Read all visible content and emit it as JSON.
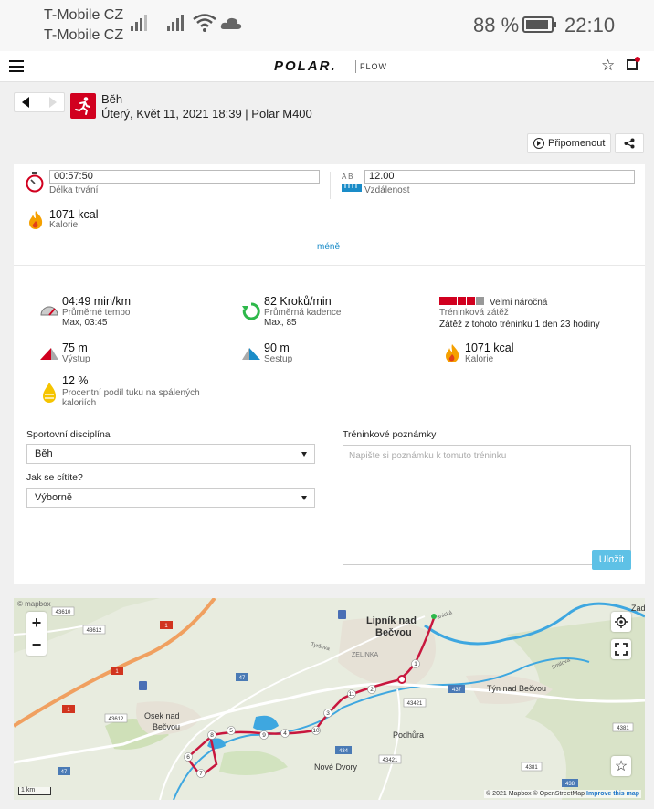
{
  "status": {
    "carrier1": "T-Mobile CZ",
    "carrier2": "T-Mobile CZ",
    "battery": "88 %",
    "time": "22:10"
  },
  "header": {
    "logo": "POLAR.",
    "product": "FLOW"
  },
  "session": {
    "title": "Běh",
    "subtitle": "Úterý, Květ 11, 2021 18:39 | Polar M400",
    "remind_label": "Připomenout"
  },
  "summary": {
    "duration_value": "00:57:50",
    "duration_label": "Délka trvání",
    "distance_value": "12.00",
    "distance_label": "Vzdálenost",
    "calories_value": "1071 kcal",
    "calories_label": "Kalorie",
    "less_link": "méně",
    "ab_label": "A  B"
  },
  "stats": {
    "pace_value": "04:49 min/km",
    "pace_label": "Průměrné tempo",
    "pace_max": "Max, 03:45",
    "cadence_value": "82 Kroků/min",
    "cadence_label": "Průměrná kadence",
    "cadence_max": "Max, 85",
    "load_level": "Velmi náročná",
    "load_label": "Tréninková zátěž",
    "load_note": "Zátěž z tohoto tréninku 1 den 23 hodiny",
    "load_filled": 4,
    "load_total": 5,
    "ascent_value": "75 m",
    "ascent_label": "Výstup",
    "descent_value": "90 m",
    "descent_label": "Sestup",
    "calories_value": "1071 kcal",
    "calories_label": "Kalorie",
    "fat_value": "12 %",
    "fat_label1": "Procentní podíl tuku na spálených",
    "fat_label2": "kaloriích"
  },
  "form": {
    "sport_label": "Sportovní disciplína",
    "sport_value": "Běh",
    "feeling_label": "Jak se cítíte?",
    "feeling_value": "Výborně",
    "notes_label": "Tréninkové poznámky",
    "notes_placeholder": "Napište si poznámku k tomuto tréninku",
    "save_label": "Uložit"
  },
  "map": {
    "zoom_in": "+",
    "zoom_out": "−",
    "scale": "1 km",
    "logo": "© mapbox",
    "attribution_prefix": "© 2021 Mapbox © OpenStreetMap",
    "attribution_link": "Improve this map",
    "labels": {
      "lipnik1": "Lipník nad",
      "lipnik2": "Bečvou",
      "osek1": "Osek nad",
      "osek2": "Bečvou",
      "tyn": "Týn nad Bečvou",
      "podhura": "Podhůra",
      "nove_dvory": "Nové Dvory",
      "zelinka": "ZELINKA",
      "zad": "Zad",
      "tyrsova": "Tyršova",
      "smilova": "Smilova",
      "panicka": "anická"
    },
    "road_numbers": {
      "r43610": "43610",
      "r43612": "43612",
      "r1a": "1",
      "r1b": "1",
      "r47a": "47",
      "r47b": "47",
      "r43612b": "43612",
      "r437": "437",
      "r43421": "43421",
      "r4381": "4381",
      "r434": "434",
      "r43421b": "43421",
      "r4381b": "4381",
      "r438": "438"
    },
    "km_markers": [
      "1",
      "2",
      "3",
      "4",
      "5",
      "6",
      "7",
      "8",
      "9",
      "10",
      "11"
    ]
  },
  "colors": {
    "polar_red": "#d1001f",
    "link_blue": "#1a8cc8",
    "save_blue": "#5ec1e6",
    "route": "#c8173e",
    "river": "#3ea7e0"
  }
}
